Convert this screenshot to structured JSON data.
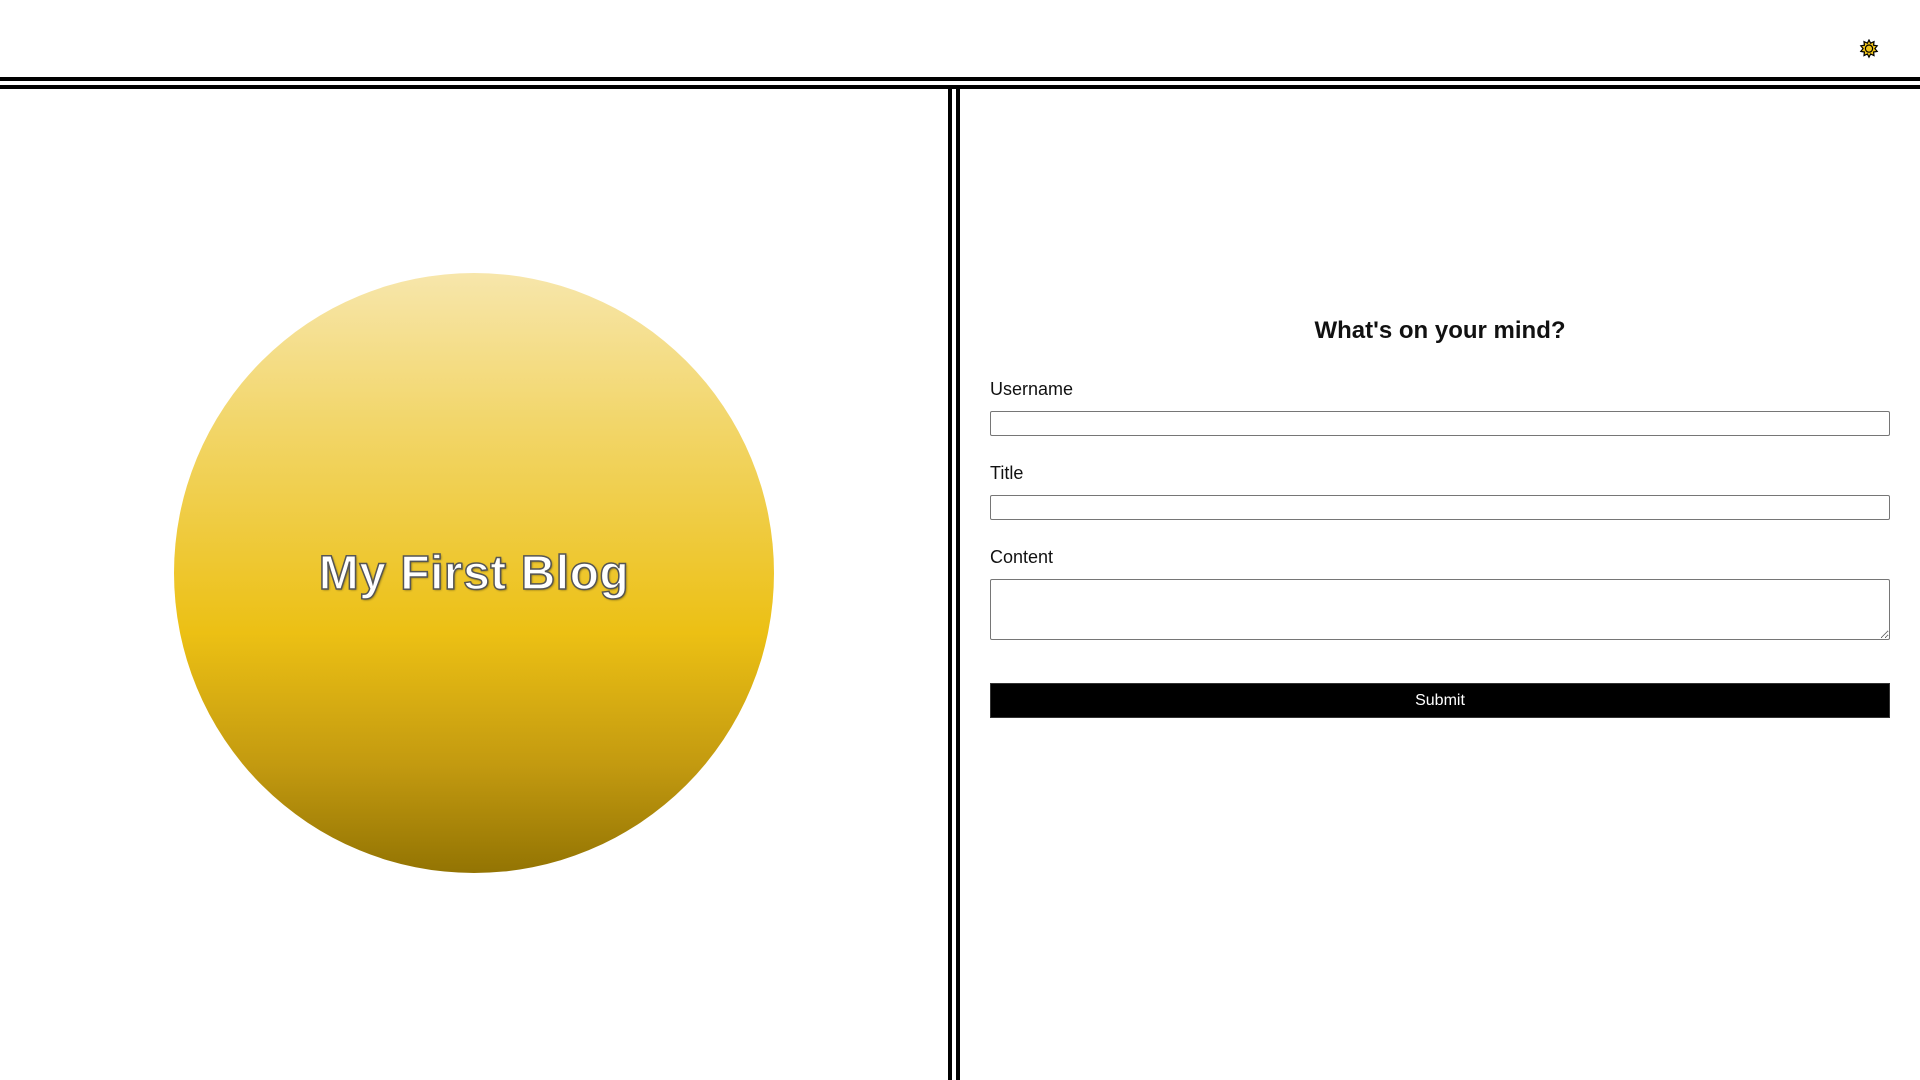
{
  "header": {
    "theme_toggle_icon": "sun-icon",
    "theme_toggle_color": "#f0c419"
  },
  "hero": {
    "title": "My First Blog",
    "circle_colors": [
      "#f7e6ab",
      "#f2d66a",
      "#ecc014",
      "#c39a10",
      "#937403"
    ]
  },
  "form": {
    "heading": "What's on your mind?",
    "username_label": "Username",
    "username_value": "",
    "title_label": "Title",
    "title_value": "",
    "content_label": "Content",
    "content_value": "",
    "submit_label": "Submit"
  },
  "colors": {
    "accent": "#ecc014",
    "button_bg": "#000000",
    "button_text": "#ffffff",
    "rule": "#000000"
  }
}
